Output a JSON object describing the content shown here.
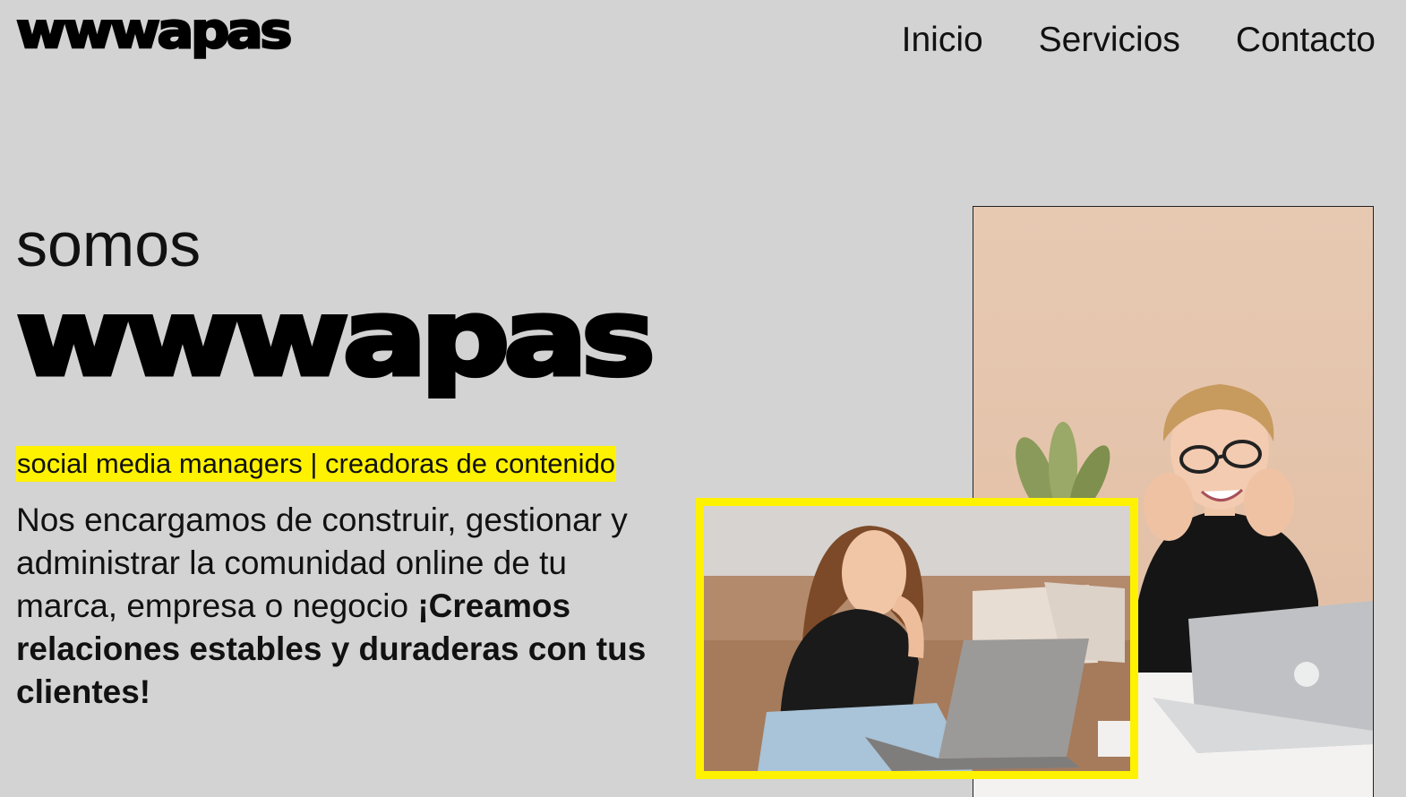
{
  "header": {
    "logo_text": "wwwapas",
    "nav": [
      {
        "label": "Inicio"
      },
      {
        "label": "Servicios"
      },
      {
        "label": "Contacto"
      }
    ]
  },
  "hero": {
    "pre_title": "somos",
    "brand": "wwwapas",
    "tagline": "social media managers | creadoras de contenido",
    "description": "Nos encargamos de construir, gestionar y administrar la comunidad online de tu marca, empresa o negocio",
    "description_bold": "¡Creamos relaciones estables y duraderas con tus clientes!"
  },
  "colors": {
    "background": "#d3d3d3",
    "accent": "#fff200",
    "text": "#111111"
  }
}
